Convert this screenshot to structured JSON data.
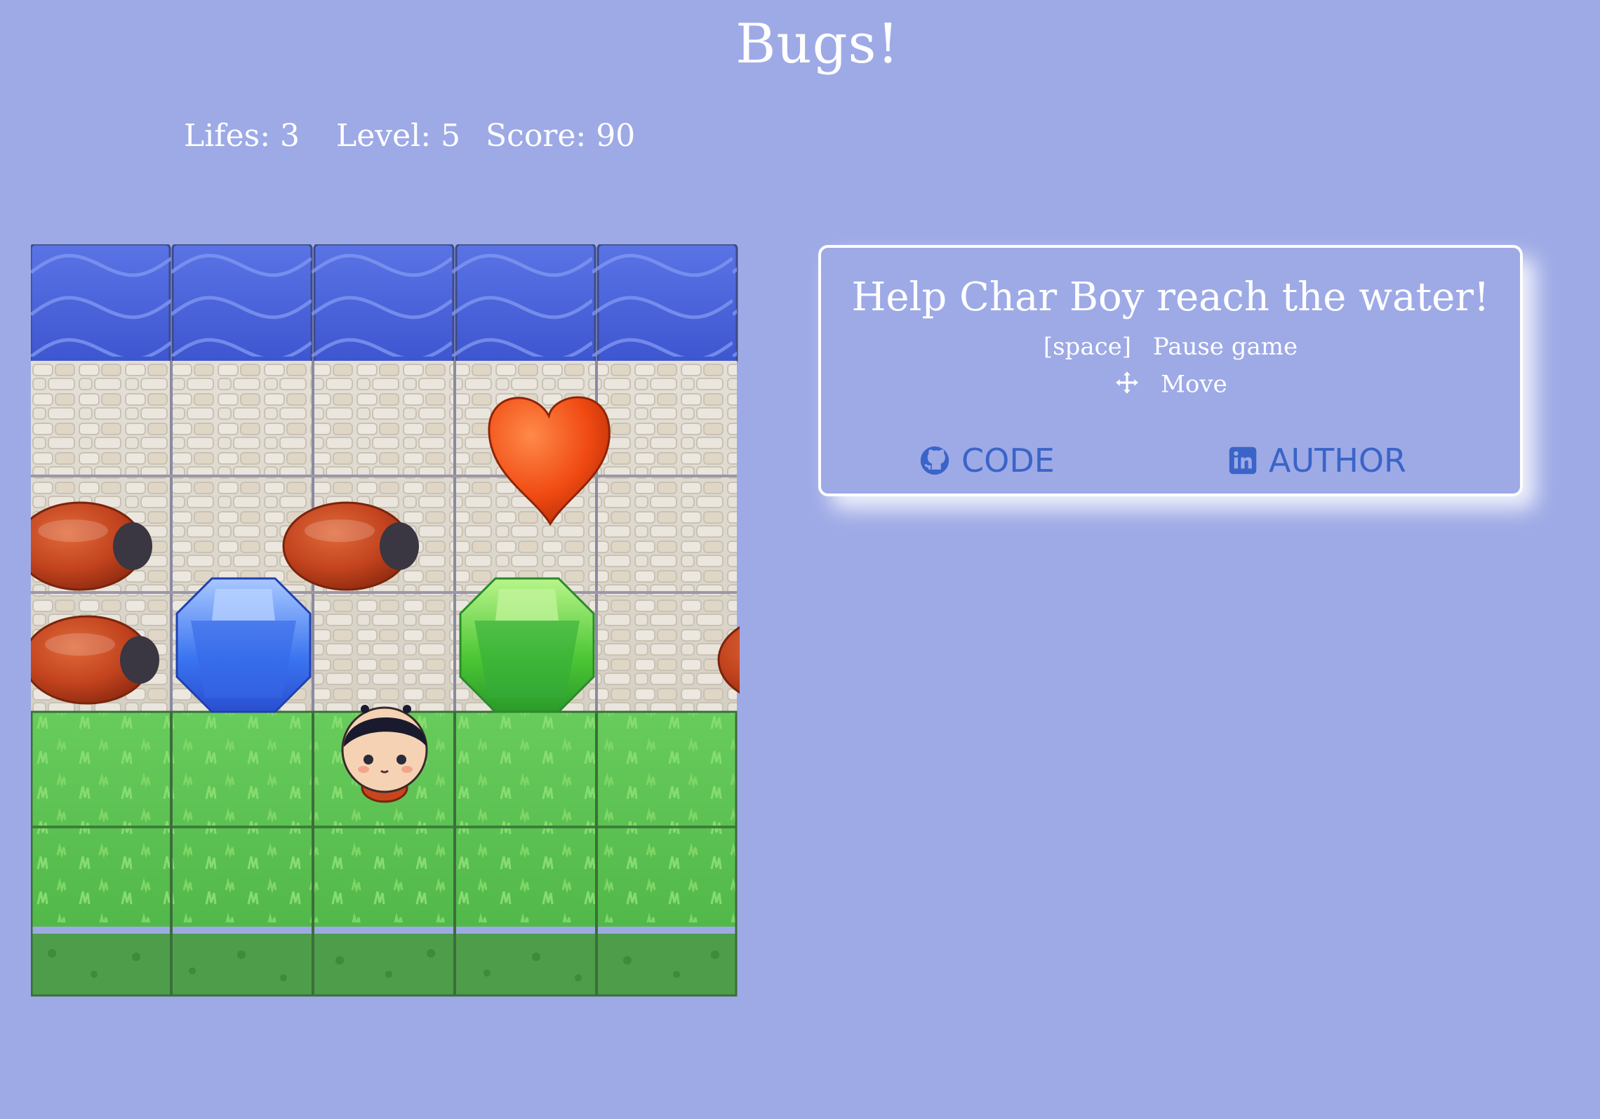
{
  "title": "Bugs!",
  "stats": {
    "lifes_label": "Lifes: 3",
    "level_label": "Level: 5",
    "score_label": "Score: 90"
  },
  "board": {
    "rows": [
      "water",
      "stone",
      "stone",
      "stone",
      "grass",
      "grass"
    ],
    "columns": 5,
    "items": [
      {
        "type": "heart",
        "row": 1,
        "col": 3
      },
      {
        "type": "gem-blue",
        "row": 3,
        "col": 1
      },
      {
        "type": "gem-green",
        "row": 3,
        "col": 3
      }
    ],
    "player": {
      "name": "Char Boy",
      "row": 4,
      "col": 2
    }
  },
  "panel": {
    "headline": "Help Char Boy reach the water!",
    "pause_key": "[space]",
    "pause_label": "Pause game",
    "move_label": "Move",
    "code_label": "CODE",
    "author_label": "AUTHOR"
  },
  "colors": {
    "background": "#9eaae6",
    "link": "#3a64c8",
    "water": "#4a62d8",
    "grass": "#5cc353",
    "stone": "#d9d3c8"
  }
}
